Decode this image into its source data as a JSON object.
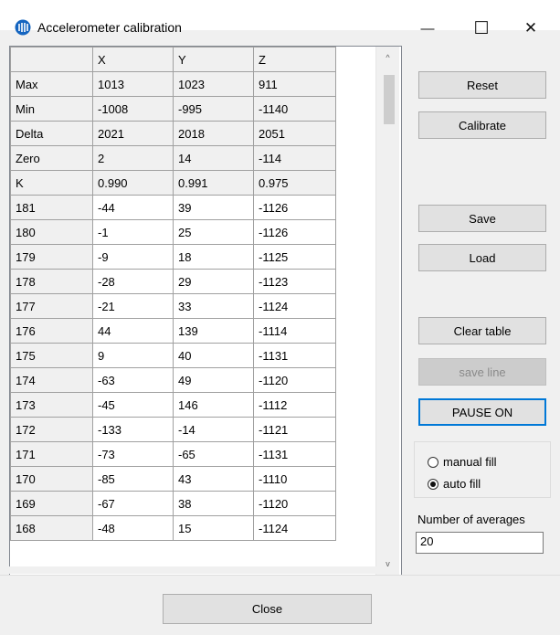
{
  "window": {
    "title": "Accelerometer calibration",
    "icon": "app-logo-icon",
    "accent": "#0078d7",
    "controls": {
      "minimize": "—",
      "maximize": "☐",
      "close": "✕"
    }
  },
  "grid": {
    "columns": [
      "",
      "X",
      "Y",
      "Z"
    ],
    "summary_rows": [
      {
        "label": "Max",
        "x": "1013",
        "y": "1023",
        "z": "911"
      },
      {
        "label": "Min",
        "x": "-1008",
        "y": "-995",
        "z": "-1140"
      },
      {
        "label": "Delta",
        "x": "2021",
        "y": "2018",
        "z": "2051"
      },
      {
        "label": "Zero",
        "x": "2",
        "y": "14",
        "z": "-114"
      },
      {
        "label": "K",
        "x": "0.990",
        "y": "0.991",
        "z": "0.975"
      }
    ],
    "data_rows": [
      {
        "label": "181",
        "x": "-44",
        "y": "39",
        "z": "-1126"
      },
      {
        "label": "180",
        "x": "-1",
        "y": "25",
        "z": "-1126"
      },
      {
        "label": "179",
        "x": "-9",
        "y": "18",
        "z": "-1125"
      },
      {
        "label": "178",
        "x": "-28",
        "y": "29",
        "z": "-1123"
      },
      {
        "label": "177",
        "x": "-21",
        "y": "33",
        "z": "-1124"
      },
      {
        "label": "176",
        "x": "44",
        "y": "139",
        "z": "-1114"
      },
      {
        "label": "175",
        "x": "9",
        "y": "40",
        "z": "-1131"
      },
      {
        "label": "174",
        "x": "-63",
        "y": "49",
        "z": "-1120"
      },
      {
        "label": "173",
        "x": "-45",
        "y": "146",
        "z": "-1112"
      },
      {
        "label": "172",
        "x": "-133",
        "y": "-14",
        "z": "-1121"
      },
      {
        "label": "171",
        "x": "-73",
        "y": "-65",
        "z": "-1131"
      },
      {
        "label": "170",
        "x": "-85",
        "y": "43",
        "z": "-1110"
      },
      {
        "label": "169",
        "x": "-67",
        "y": "38",
        "z": "-1120"
      },
      {
        "label": "168",
        "x": "-48",
        "y": "15",
        "z": "-1124"
      }
    ]
  },
  "buttons": {
    "reset": "Reset",
    "calibrate": "Calibrate",
    "save": "Save",
    "load": "Load",
    "clear_table": "Clear table",
    "save_line": "save line",
    "pause": "PAUSE ON",
    "close": "Close"
  },
  "fill_mode": {
    "manual": "manual fill",
    "auto": "auto fill",
    "selected": "auto"
  },
  "averages": {
    "label": "Number of averages",
    "value": "20"
  },
  "scrollbar": {
    "up": "^",
    "down": "v"
  }
}
